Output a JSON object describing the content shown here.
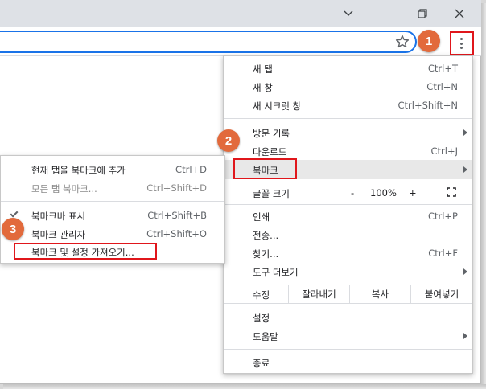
{
  "menu": {
    "items": [
      {
        "label": "새 탭",
        "shortcut": "Ctrl+T"
      },
      {
        "label": "새 창",
        "shortcut": "Ctrl+N"
      },
      {
        "label": "새 시크릿 창",
        "shortcut": "Ctrl+Shift+N"
      },
      {
        "label": "방문 기록",
        "shortcut": ""
      },
      {
        "label": "다운로드",
        "shortcut": "Ctrl+J"
      },
      {
        "label": "북마크",
        "shortcut": ""
      },
      {
        "label": "인쇄",
        "shortcut": "Ctrl+P"
      },
      {
        "label": "전송...",
        "shortcut": ""
      },
      {
        "label": "찾기...",
        "shortcut": "Ctrl+F"
      },
      {
        "label": "도구 더보기",
        "shortcut": ""
      },
      {
        "label": "설정",
        "shortcut": ""
      },
      {
        "label": "도움말",
        "shortcut": ""
      },
      {
        "label": "종료",
        "shortcut": ""
      }
    ],
    "zoom": {
      "label": "글꼴 크기",
      "minus": "-",
      "value": "100%",
      "plus": "+"
    },
    "edit": {
      "label": "수정",
      "cut": "잘라내기",
      "copy": "복사",
      "paste": "붙여넣기"
    }
  },
  "bookmark_submenu": {
    "items": [
      {
        "label": "현재 탭을 북마크에 추가",
        "shortcut": "Ctrl+D",
        "enabled": true
      },
      {
        "label": "모든 탭 북마크...",
        "shortcut": "Ctrl+Shift+D",
        "enabled": false
      },
      {
        "label": "북마크바 표시",
        "shortcut": "Ctrl+Shift+B",
        "checked": true
      },
      {
        "label": "북마크 관리자",
        "shortcut": "Ctrl+Shift+O"
      },
      {
        "label": "북마크 및 설정 가져오기...",
        "shortcut": ""
      }
    ]
  },
  "callouts": {
    "step1": "1",
    "step2": "2",
    "step3": "3"
  },
  "colors": {
    "callout": "#e26a3c",
    "highlight_box": "#e0161b",
    "omnibox_focus": "#1a73e8"
  },
  "icons": [
    "chevron-down-icon",
    "restore-icon",
    "close-icon",
    "star-icon",
    "more-vert-icon",
    "fullscreen-icon",
    "check-icon",
    "submenu-arrow-icon"
  ]
}
